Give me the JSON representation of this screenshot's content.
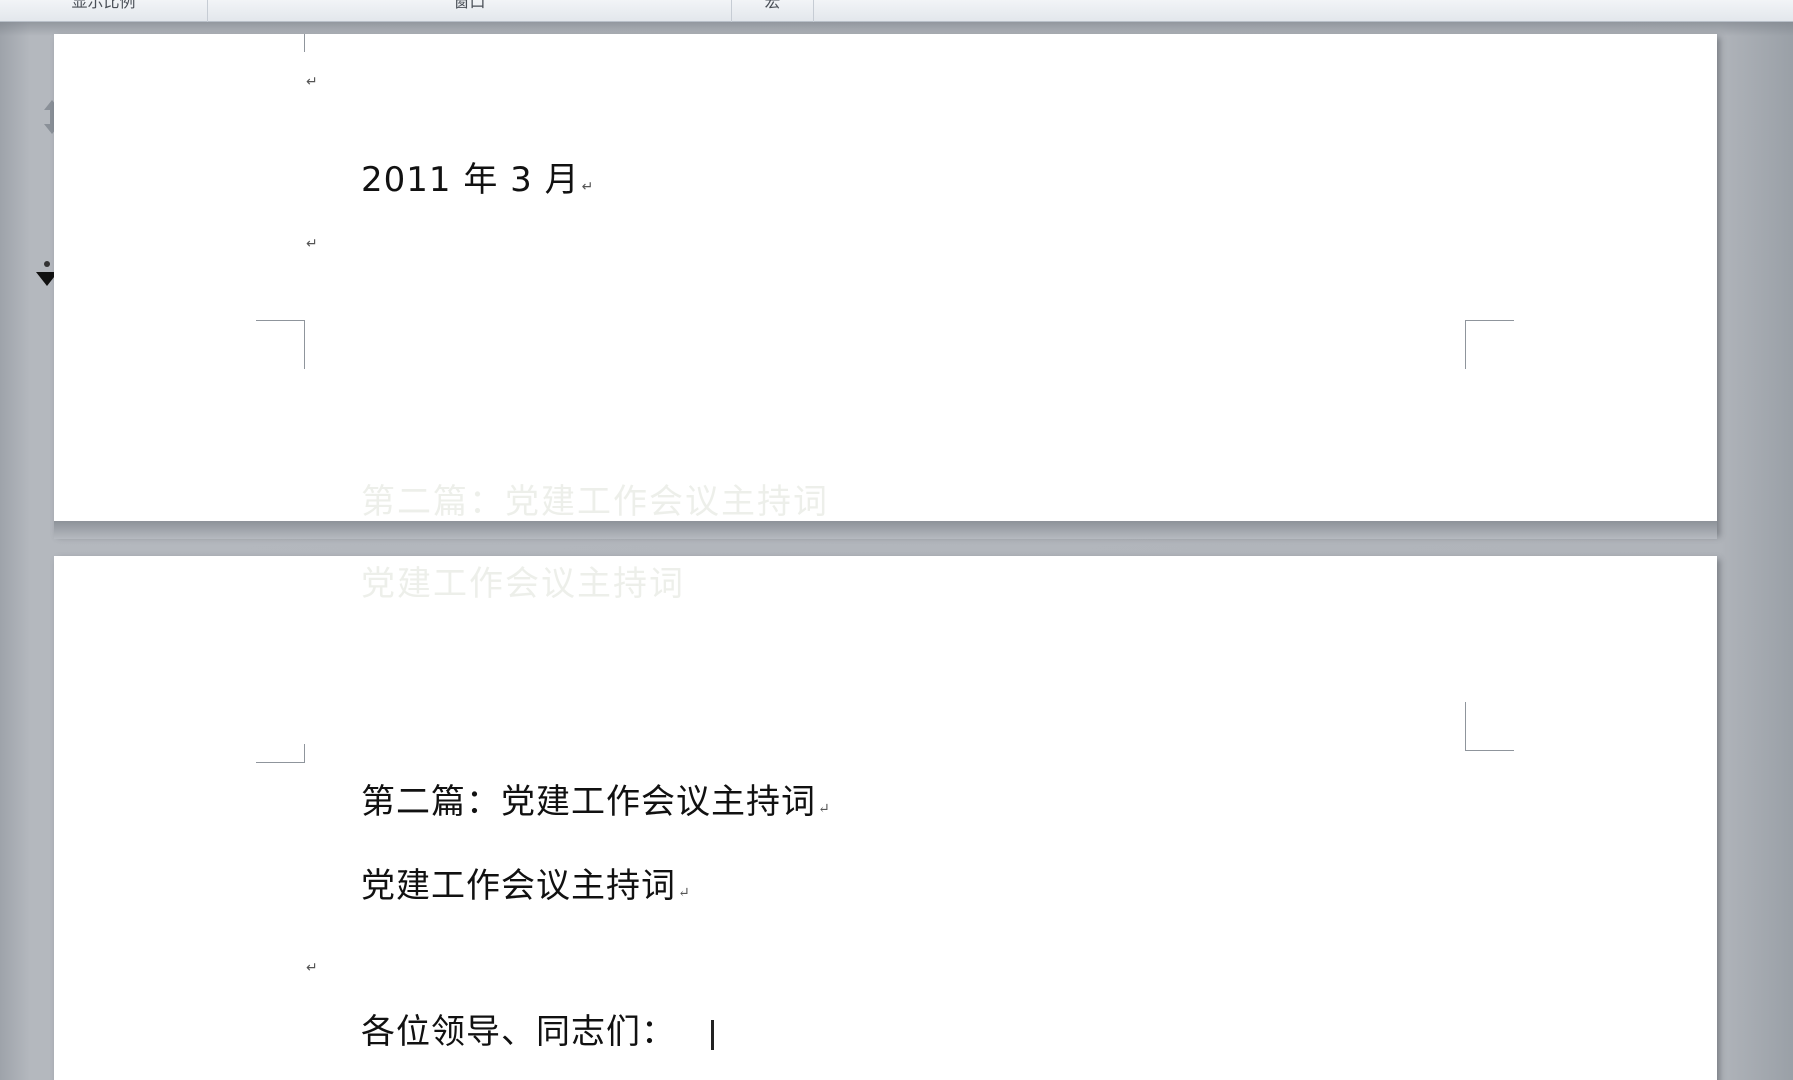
{
  "ribbon": {
    "groups": [
      {
        "label": "显示比例"
      },
      {
        "label": "窗口"
      },
      {
        "label": "宏"
      }
    ]
  },
  "page1": {
    "date": "2011 年 3 月",
    "para_mark": "↵"
  },
  "page2": {
    "heading": "第二篇：党建工作会议主持词",
    "title": "党建工作会议主持词",
    "greeting": "各位领导、同志们：",
    "para_mark": "↵"
  },
  "icons": {
    "scroll_marker": "split-arrows-icon",
    "ruler_marker": "down-triangle-icon"
  }
}
